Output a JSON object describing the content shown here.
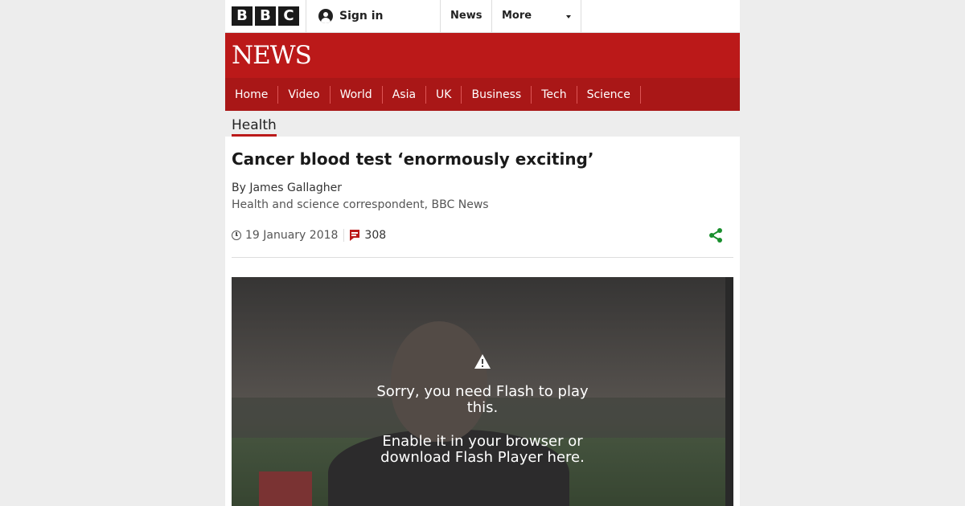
{
  "header": {
    "brand_letters": [
      "B",
      "B",
      "C"
    ],
    "signin_label": "Sign in",
    "nav": [
      {
        "label": "News"
      },
      {
        "label": "More"
      }
    ]
  },
  "banner": {
    "title": "NEWS",
    "brand_color": "#bb1919"
  },
  "section_nav": [
    {
      "label": "Home"
    },
    {
      "label": "Video"
    },
    {
      "label": "World"
    },
    {
      "label": "Asia"
    },
    {
      "label": "UK"
    },
    {
      "label": "Business"
    },
    {
      "label": "Tech"
    },
    {
      "label": "Science"
    }
  ],
  "breadcrumb": {
    "label": "Health"
  },
  "article": {
    "headline": "Cancer blood test ‘enormously exciting’",
    "byline": "By James Gallagher",
    "role": "Health and science correspondent, BBC News",
    "date": "19 January 2018",
    "comments": "308",
    "share_icon": "share-icon",
    "share_color": "#1a8f2e"
  },
  "video": {
    "message": "Sorry, you need Flash to play this.",
    "instruction": "Enable it in your browser or download Flash Player here.",
    "icon": "warning-icon"
  }
}
